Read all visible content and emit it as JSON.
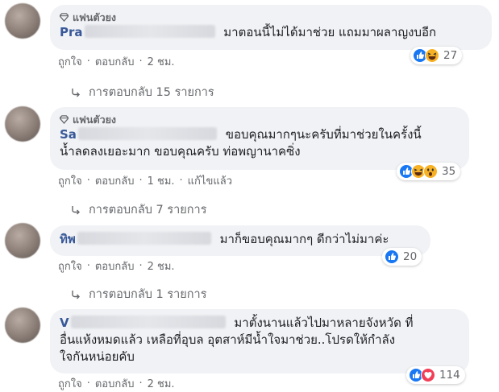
{
  "comments": [
    {
      "badge": "แฟนตัวยง",
      "author_prefix": "Pra",
      "lines": [
        "มาตอนนี้ไม่ได้มาช่วย แถมมาผลาญงบอีก"
      ],
      "meta": {
        "like": "ถูกใจ",
        "reply": "ตอบกลับ",
        "time": "2 ชม.",
        "edited": ""
      },
      "reaction_count": "27",
      "reactions": [
        "like",
        "haha"
      ],
      "replies_label": "การตอบกลับ 15 รายการ"
    },
    {
      "badge": "แฟนตัวยง",
      "author_prefix": "Sa",
      "lines": [
        "ขอบคุณมากๆนะครับที่มาช่วยในครั้งนี้",
        "น้ำลดลงเยอะมาก ขอบคุณครับ ท่อพญานาคซิ่ง"
      ],
      "meta": {
        "like": "ถูกใจ",
        "reply": "ตอบกลับ",
        "time": "1 ชม.",
        "edited": "แก้ไขแล้ว"
      },
      "reaction_count": "35",
      "reactions": [
        "like",
        "haha",
        "wow"
      ],
      "replies_label": "การตอบกลับ 7 รายการ"
    },
    {
      "badge": "",
      "author_prefix": "ทิพ",
      "lines": [
        "มาก็ขอบคุณมากๆ ดีกว่าไม่มาค่ะ"
      ],
      "meta": {
        "like": "ถูกใจ",
        "reply": "ตอบกลับ",
        "time": "2 ชม.",
        "edited": ""
      },
      "reaction_count": "20",
      "reactions": [
        "like"
      ],
      "replies_label": "การตอบกลับ 1 รายการ"
    },
    {
      "badge": "",
      "author_prefix": "V",
      "lines": [
        "มาตั้งนานแล้วไปมาหลายจังหวัด ที่",
        "อื่นแห้งหมดแล้ว เหลือที่อุบล อุตสาห์มีน้ำใจมาช่วย..โปรดให้กำลัง",
        "ใจกันหน่อยคับ"
      ],
      "meta": {
        "like": "ถูกใจ",
        "reply": "ตอบกลับ",
        "time": "2 ชม.",
        "edited": ""
      },
      "reaction_count": "114",
      "reactions": [
        "like",
        "love"
      ],
      "replies_label": ""
    }
  ],
  "separator": "·",
  "colors": {
    "like": "#1877f2",
    "haha": "#f7b125",
    "love": "#f33e58",
    "author": "#385898",
    "meta": "#65676b",
    "bubble": "#f0f2f5"
  }
}
